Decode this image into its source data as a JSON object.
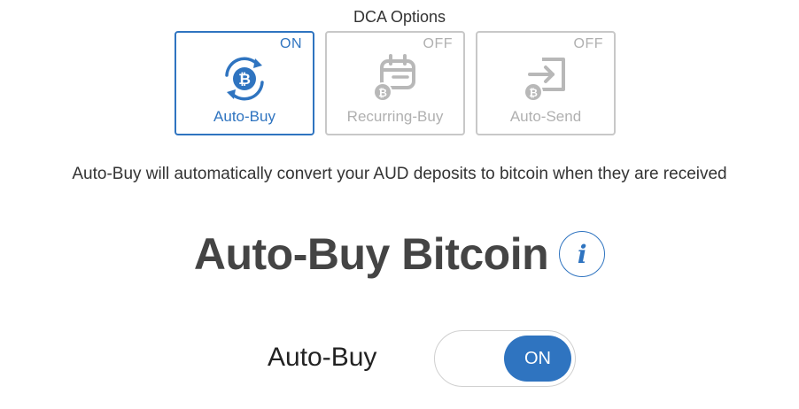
{
  "dca": {
    "title": "DCA Options",
    "options": [
      {
        "label": "Auto-Buy",
        "state": "ON",
        "icon": "bitcoin-cycle-icon",
        "active": true
      },
      {
        "label": "Recurring-Buy",
        "state": "OFF",
        "icon": "bitcoin-calendar-icon",
        "active": false
      },
      {
        "label": "Auto-Send",
        "state": "OFF",
        "icon": "bitcoin-send-icon",
        "active": false
      }
    ]
  },
  "description": "Auto-Buy will automatically convert your AUD deposits to bitcoin when they are received",
  "main": {
    "heading": "Auto-Buy Bitcoin",
    "info_glyph": "i"
  },
  "toggle": {
    "label": "Auto-Buy",
    "state": "ON"
  },
  "colors": {
    "accent": "#2f74c0",
    "inactive": "#b0b0b0",
    "border_inactive": "#c8c8c8",
    "text": "#333333"
  }
}
